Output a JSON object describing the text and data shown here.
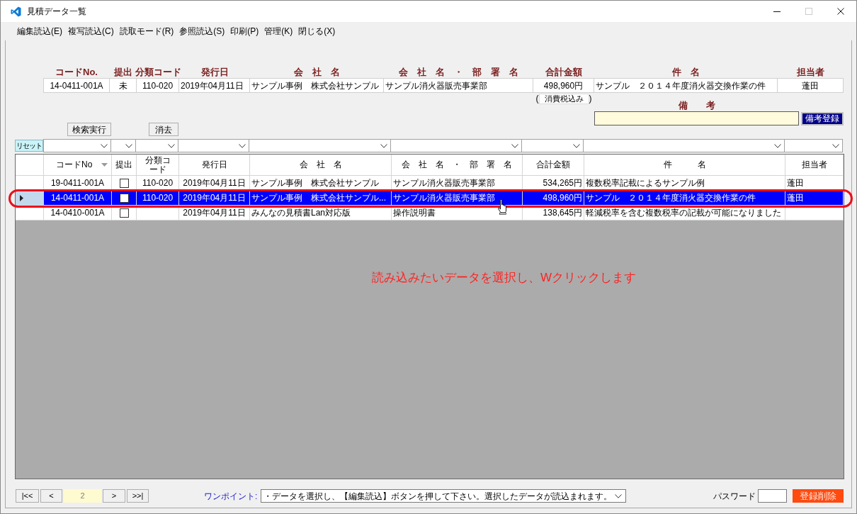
{
  "window": {
    "title": "見積データ一覧",
    "controls": [
      {
        "kind": "minimize",
        "disabled": false
      },
      {
        "kind": "maximize",
        "disabled": true
      },
      {
        "kind": "close",
        "disabled": false
      }
    ]
  },
  "menu": [
    "編集読込(E)",
    "複写読込(C)",
    "読取モード(R)",
    "参照読込(S)",
    "印刷(P)",
    "管理(K)",
    "閉じる(X)"
  ],
  "header": {
    "fields": [
      {
        "label": "コードNo.",
        "value": "14-0411-001A"
      },
      {
        "label": "提出",
        "value": "未"
      },
      {
        "label": "分類コード",
        "value": "110-020"
      },
      {
        "label": "発行日",
        "value": "2019年04月11日"
      },
      {
        "label": "会　社　名",
        "value": "サンプル事例　株式会社サンプル"
      },
      {
        "label": "会　社　名　・　部　署　名",
        "value": "サンプル消火器販売事業部"
      },
      {
        "label": "合計金額",
        "value": "498,960円"
      },
      {
        "label": "件　名",
        "value": "サンプル　２０１４年度消火器交換作業の件"
      },
      {
        "label": "担当者",
        "value": "蓬田"
      }
    ],
    "tax_note": {
      "open": "(",
      "label": "消費税込み",
      "close": ")"
    },
    "remarks": {
      "label": "備　　考",
      "button": "備考登録"
    }
  },
  "search_buttons": [
    "検索実行",
    "消去"
  ],
  "filter": {
    "reset": "リセット"
  },
  "table": {
    "columns": [
      {
        "label": "コードNo",
        "kind": "text",
        "sorted": true
      },
      {
        "label": "提出",
        "kind": "checkbox",
        "sorted": false
      },
      {
        "label": "分類コード",
        "kind": "text",
        "sorted": false
      },
      {
        "label": "発行日",
        "kind": "text",
        "sorted": false
      },
      {
        "label": "会　社　名",
        "kind": "text",
        "sorted": false
      },
      {
        "label": "会　社　名　・　部　署　名",
        "kind": "text",
        "sorted": false
      },
      {
        "label": "合計金額",
        "kind": "text",
        "sorted": false
      },
      {
        "label": "件　　　名",
        "kind": "text",
        "sorted": false
      },
      {
        "label": "担当者",
        "kind": "text",
        "sorted": false
      }
    ],
    "rows": [
      {
        "selected": false,
        "code_no": "19-0411-001A",
        "submitted": false,
        "category_code": "110-020",
        "issue_date": "2019年04月11日",
        "company": "サンプル事例　株式会社サンプル",
        "company_department": "サンプル消火器販売事業部",
        "total_amount": "534,265円",
        "subject": "複数税率記載によるサンプル例",
        "person_in_charge": "蓬田"
      },
      {
        "selected": true,
        "code_no": "14-0411-001A",
        "submitted": false,
        "category_code": "110-020",
        "issue_date": "2019年04月11日",
        "company": "サンプル事例　株式会社サンプル...",
        "company_department": "サンプル消火器販売事業部",
        "total_amount": "498,960円",
        "subject": "サンプル　２０１４年度消火器交換作業の件",
        "person_in_charge": "蓬田"
      },
      {
        "selected": false,
        "code_no": "14-0410-001A",
        "submitted": false,
        "issue_date": "2019年04月11日",
        "company": "みんなの見積書Lan対応版",
        "company_department": "操作説明書",
        "total_amount": "138,645円",
        "subject": "軽減税率を含む複数税率の記載が可能になりました"
      }
    ]
  },
  "annotation": "読み込みたいデータを選択し、Wクリックします",
  "footer": {
    "pager": {
      "buttons": [
        "|<<",
        "<",
        ">",
        ">>|"
      ],
      "page": "2"
    },
    "tip_label": "ワンポイント:",
    "tip": "・データを選択し、【編集読込】ボタンを押して下さい。選択したデータが読込まれます。",
    "password_label": "パスワード",
    "delete_button": "登録削除"
  }
}
